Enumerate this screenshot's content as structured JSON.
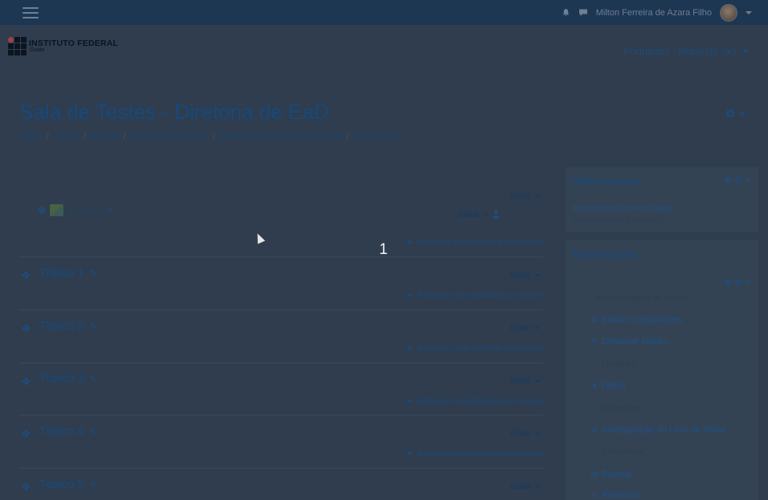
{
  "topbar": {
    "user_name": "Milton Ferreira de Azara Filho"
  },
  "brand": {
    "line1": "INSTITUTO FEDERAL",
    "line2": "Goiás"
  },
  "language": {
    "selected": "Português - Brasil (pt_br)"
  },
  "course": {
    "title": "Sala de Testes - Diretoria de EaD",
    "breadcrumb": [
      "Painel",
      "Cursos",
      "Reitoria",
      "Pró-reitoria de Ensino",
      "Diretoria de Educação a Distância",
      "ST.DIR.EAD"
    ]
  },
  "sections": {
    "edit_label": "Editar",
    "add_label": "Adicionar uma atividade ou recurso",
    "avisos": "Avisos",
    "topics": [
      "Tópico 1",
      "Tópico 2",
      "Tópico 3",
      "Tópico 4",
      "Tópico 5"
    ]
  },
  "overlay": {
    "step": "1"
  },
  "blocks": {
    "news": {
      "title": "Últimos avisos",
      "add_topic": "Acrescentar um novo tópico...",
      "empty": "(Nenhum aviso publicado.)"
    },
    "admin": {
      "title": "Administração",
      "items": [
        "Administração do curso",
        "Editar configurações",
        "Desativar edição",
        "Usuários",
        "Filtros",
        "Relatórios",
        "Configuração do Livro de Notas",
        "Emblemas",
        "Backup",
        "Restaurar"
      ]
    }
  },
  "icons": {
    "menu": "hamburger-icon",
    "bell": "bell-icon",
    "chat": "chat-icon",
    "gear": "gear-icon",
    "move": "move-icon",
    "pencil": "pencil-icon",
    "plus": "plus-icon",
    "user": "user-icon",
    "filter": "filter-icon"
  },
  "colors": {
    "navbar": "#1d3652",
    "overlay_bg": "#2f3d4e",
    "link": "#1c5188"
  }
}
